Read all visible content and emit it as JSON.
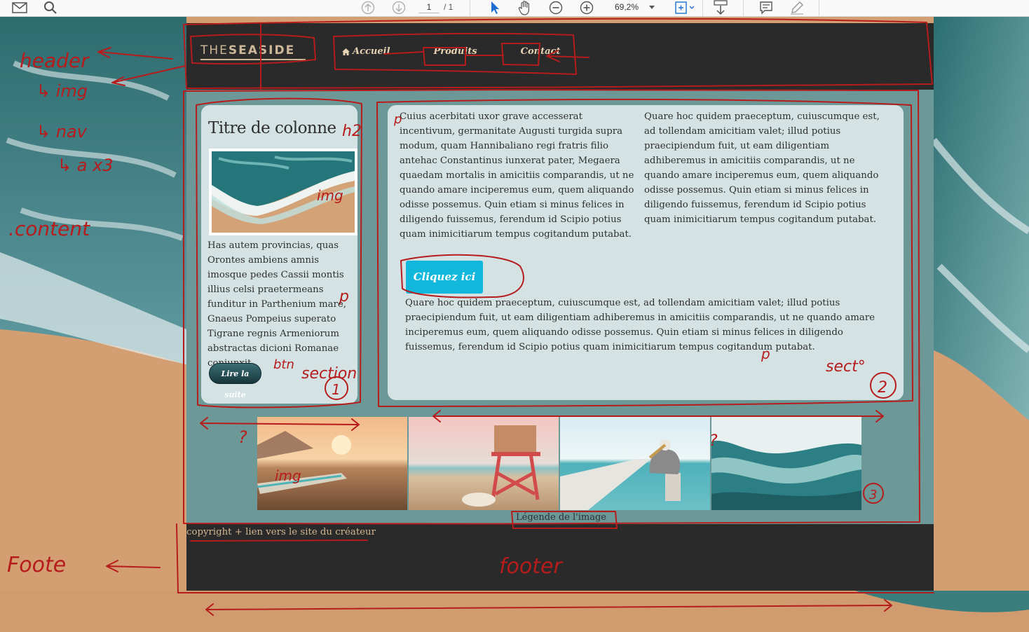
{
  "viewer": {
    "page_current": "1",
    "page_total": "/ 1",
    "zoom": "69,2%",
    "icons": [
      "mail-icon",
      "search-icon",
      "page-up-icon",
      "page-down-icon",
      "select-cursor-icon",
      "hand-tool-icon",
      "zoom-out-icon",
      "zoom-in-icon",
      "fit-page-icon",
      "download-icon",
      "comment-icon",
      "pen-icon"
    ]
  },
  "site": {
    "logo_light": "THE",
    "logo_bold": "SEASIDE",
    "nav": [
      {
        "label": "Accueil",
        "icon": "home-icon"
      },
      {
        "label": "Produits"
      },
      {
        "label": "Contact"
      }
    ],
    "left_column": {
      "title": "Titre de colonne",
      "text": "Has autem provincias, quas Orontes ambiens amnis imosque pedes Cassii montis illius celsi praetermeans funditur in Parthenium mare, Gnaeus Pompeius superato Tigrane regnis Armeniorum abstractas dicioni Romanae coniunxit.",
      "button": "Lire la suite"
    },
    "right_column": {
      "text_col1": "Cuius acerbitati uxor grave accesserat incentivum, germanitate Augusti turgida supra modum, quam Hannibaliano regi fratris filio antehac Constantinus iunxerat pater, Megaera quaedam mortalis in amicitiis comparandis, ut ne quando amare inciperemus eum, quem aliquando odisse possemus. Quin etiam si minus felices in diligendo fuissemus, ferendum id Scipio potius quam inimicitiarum tempus cogitandum putabat.",
      "text_col2": "Quare hoc quidem praeceptum, cuiuscumque est, ad tollendam amicitiam valet; illud potius praecipiendum fuit, ut eam diligentiam adhiberemus in amicitiis comparandis, ut ne quando amare inciperemus eum, quem aliquando odisse possemus. Quin etiam si minus felices in diligendo fuissemus, ferendum id Scipio potius quam inimicitiarum tempus cogitandum putabat.",
      "button": "Cliquez ici",
      "text_bottom": "Quare hoc quidem praeceptum, cuiuscumque est, ad tollendam amicitiam valet; illud potius praecipiendum fuit, ut eam diligentiam adhiberemus in amicitiis comparandis, ut ne quando amare inciperemus eum, quem aliquando odisse possemus. Quin etiam si minus felices in diligendo fuissemus, ferendum id Scipio potius quam inimicitiarum tempus cogitandum putabat."
    },
    "gallery": [
      "sunset-beach-surfboard",
      "lifeguard-tower",
      "pelican-on-pier",
      "ocean-wave"
    ],
    "caption": "Légende de l'image",
    "footer": "copyright + lien vers le site du créateur"
  },
  "annotations": {
    "header": "header",
    "img": "↳ img",
    "nav": "↳ nav",
    "a_x3": "↳ a x3",
    "content": ".content",
    "h2": "h2",
    "img_thumb": "img",
    "p_marker": "p",
    "btn": "btn",
    "section": "section",
    "num1": "1",
    "num2": "2",
    "num3": "3",
    "sect": "sect°",
    "img_gallery": "img",
    "question": "?",
    "footer_left": "Foote",
    "footer_center": "footer",
    "red": "#b71c1c"
  }
}
